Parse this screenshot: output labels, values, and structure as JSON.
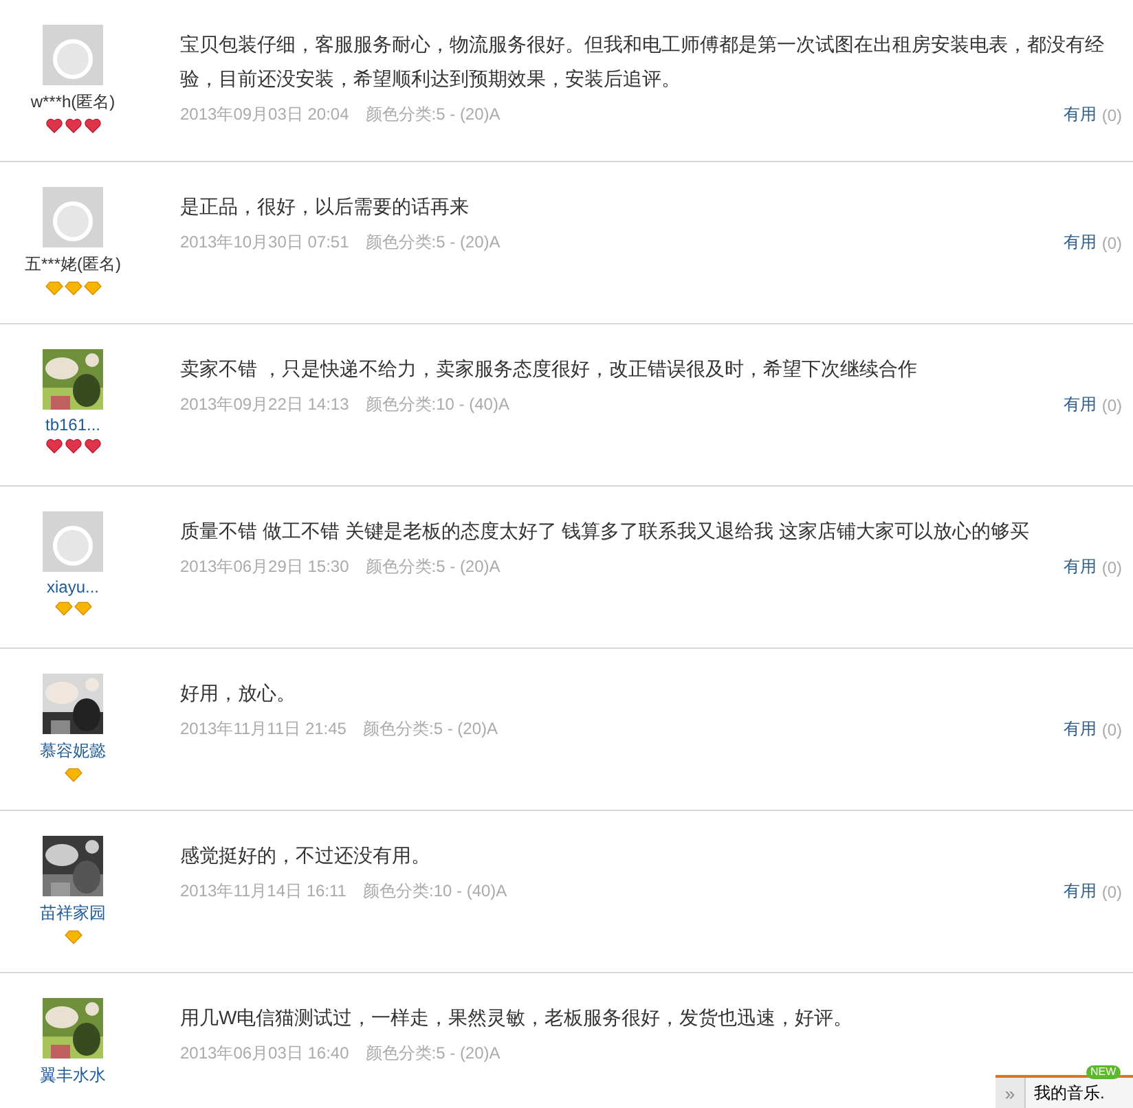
{
  "reviews": [
    {
      "avatar": {
        "kind": "default"
      },
      "user": "w***h(匿名)",
      "linked": false,
      "badges": [
        {
          "kind": "heart"
        },
        {
          "kind": "heart"
        },
        {
          "kind": "heart"
        }
      ],
      "text": "宝贝包装仔细，客服服务耐心，物流服务很好。但我和电工师傅都是第一次试图在出租房安装电表，都没有经验，目前还没安装，希望顺利达到预期效果，安装后追评。",
      "date": "2013年09月03日 20:04",
      "sku": "颜色分类:5 - (20)A",
      "helpful": "有用",
      "count": "(0)"
    },
    {
      "avatar": {
        "kind": "default"
      },
      "user": "五***姥(匿名)",
      "linked": false,
      "badges": [
        {
          "kind": "diamond"
        },
        {
          "kind": "diamond"
        },
        {
          "kind": "diamond"
        }
      ],
      "text": "是正品，很好，以后需要的话再来",
      "date": "2013年10月30日 07:51",
      "sku": "颜色分类:5 - (20)A",
      "helpful": "有用",
      "count": "(0)"
    },
    {
      "avatar": {
        "kind": "picture"
      },
      "user": "tb161...",
      "linked": true,
      "badges": [
        {
          "kind": "heart"
        },
        {
          "kind": "heart"
        },
        {
          "kind": "heart"
        }
      ],
      "text": "卖家不错 ，只是快递不给力，卖家服务态度很好，改正错误很及时，希望下次继续合作",
      "date": "2013年09月22日 14:13",
      "sku": "颜色分类:10 - (40)A",
      "helpful": "有用",
      "count": "(0)"
    },
    {
      "avatar": {
        "kind": "default"
      },
      "user": "xiayu...",
      "linked": true,
      "badges": [
        {
          "kind": "diamond"
        },
        {
          "kind": "diamond"
        }
      ],
      "text": "质量不错 做工不错 关键是老板的态度太好了 钱算多了联系我又退给我 这家店铺大家可以放心的够买",
      "date": "2013年06月29日 15:30",
      "sku": "颜色分类:5 - (20)A",
      "helpful": "有用",
      "count": "(0)"
    },
    {
      "avatar": {
        "kind": "picture"
      },
      "user": "慕容妮懿",
      "linked": true,
      "badges": [
        {
          "kind": "diamond"
        }
      ],
      "text": "好用，放心。",
      "date": "2013年11月11日 21:45",
      "sku": "颜色分类:5 - (20)A",
      "helpful": "有用",
      "count": "(0)"
    },
    {
      "avatar": {
        "kind": "picture"
      },
      "user": "苗祥家园",
      "linked": true,
      "badges": [
        {
          "kind": "diamond"
        }
      ],
      "text": "感觉挺好的，不过还没有用。",
      "date": "2013年11月14日 16:11",
      "sku": "颜色分类:10 - (40)A",
      "helpful": "有用",
      "count": "(0)"
    },
    {
      "avatar": {
        "kind": "picture"
      },
      "user": "翼丰水水",
      "linked": true,
      "text": "用几W电信猫测试过，一样走，果然灵敏，老板服务很好，发货也迅速，好评。",
      "date": "2013年06月03日 16:40",
      "sku": "颜色分类:5 - (20)A"
    }
  ],
  "music_bar": {
    "expand": "»",
    "label": "我的音乐.",
    "badge": "NEW"
  }
}
